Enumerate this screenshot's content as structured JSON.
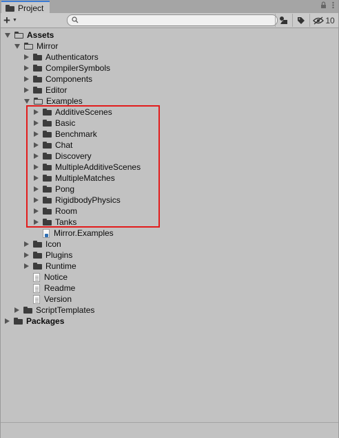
{
  "window": {
    "tab_label": "Project",
    "lock_icon": "lock-icon",
    "menu_icon": "menu-icon"
  },
  "toolbar": {
    "create_label": "+",
    "search": {
      "value": "",
      "placeholder": ""
    },
    "hidden_count": "10"
  },
  "tree": [
    {
      "label": "Assets",
      "depth": 0,
      "kind": "folder",
      "expanded": true,
      "bold": true
    },
    {
      "label": "Mirror",
      "depth": 1,
      "kind": "folder",
      "expanded": true
    },
    {
      "label": "Authenticators",
      "depth": 2,
      "kind": "folder",
      "expanded": false
    },
    {
      "label": "CompilerSymbols",
      "depth": 2,
      "kind": "folder",
      "expanded": false
    },
    {
      "label": "Components",
      "depth": 2,
      "kind": "folder",
      "expanded": false
    },
    {
      "label": "Editor",
      "depth": 2,
      "kind": "folder",
      "expanded": false
    },
    {
      "label": "Examples",
      "depth": 2,
      "kind": "folder",
      "expanded": true
    },
    {
      "label": "AdditiveScenes",
      "depth": 3,
      "kind": "folder",
      "expanded": false
    },
    {
      "label": "Basic",
      "depth": 3,
      "kind": "folder",
      "expanded": false
    },
    {
      "label": "Benchmark",
      "depth": 3,
      "kind": "folder",
      "expanded": false
    },
    {
      "label": "Chat",
      "depth": 3,
      "kind": "folder",
      "expanded": false
    },
    {
      "label": "Discovery",
      "depth": 3,
      "kind": "folder",
      "expanded": false
    },
    {
      "label": "MultipleAdditiveScenes",
      "depth": 3,
      "kind": "folder",
      "expanded": false
    },
    {
      "label": "MultipleMatches",
      "depth": 3,
      "kind": "folder",
      "expanded": false
    },
    {
      "label": "Pong",
      "depth": 3,
      "kind": "folder",
      "expanded": false
    },
    {
      "label": "RigidbodyPhysics",
      "depth": 3,
      "kind": "folder",
      "expanded": false
    },
    {
      "label": "Room",
      "depth": 3,
      "kind": "folder",
      "expanded": false
    },
    {
      "label": "Tanks",
      "depth": 3,
      "kind": "folder",
      "expanded": false
    },
    {
      "label": "Mirror.Examples",
      "depth": 3,
      "kind": "assembly"
    },
    {
      "label": "Icon",
      "depth": 2,
      "kind": "folder",
      "expanded": false
    },
    {
      "label": "Plugins",
      "depth": 2,
      "kind": "folder",
      "expanded": false
    },
    {
      "label": "Runtime",
      "depth": 2,
      "kind": "folder",
      "expanded": false
    },
    {
      "label": "Notice",
      "depth": 2,
      "kind": "file"
    },
    {
      "label": "Readme",
      "depth": 2,
      "kind": "file"
    },
    {
      "label": "Version",
      "depth": 2,
      "kind": "file"
    },
    {
      "label": "ScriptTemplates",
      "depth": 1,
      "kind": "folder",
      "expanded": false
    },
    {
      "label": "Packages",
      "depth": 0,
      "kind": "folder",
      "expanded": false,
      "bold": true
    }
  ],
  "colors": {
    "panel_bg": "#c2c2c2",
    "tab_accent": "#3a7bd5",
    "highlight_box": "#e21b1b"
  }
}
